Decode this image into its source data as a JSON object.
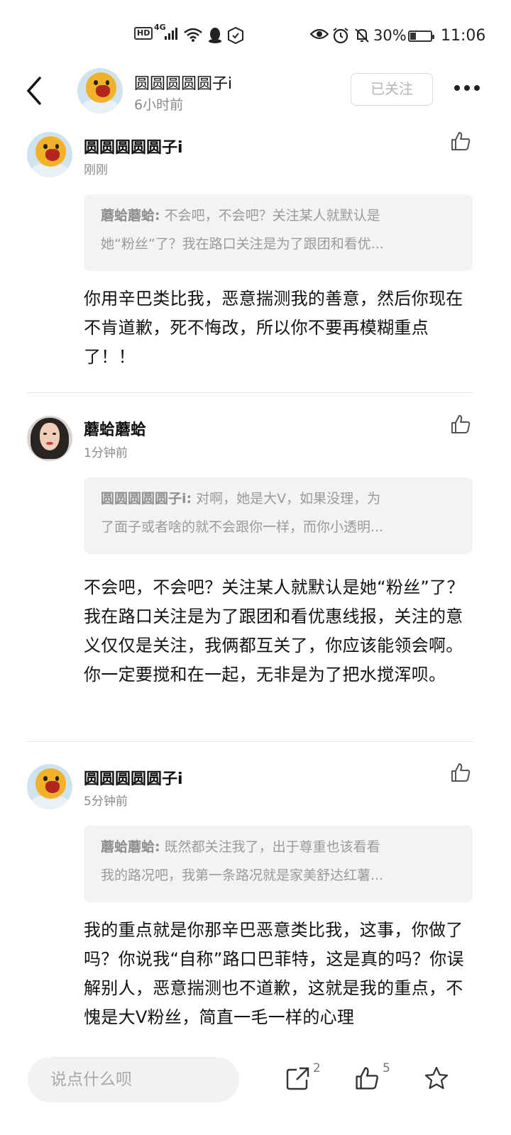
{
  "status_bar": {
    "hd": "HD",
    "network": "4G",
    "battery_pct": "30%",
    "battery_level": 0.3,
    "time": "11:06"
  },
  "header": {
    "author_name": "圆圆圆圆圆子i",
    "post_time": "6小时前",
    "follow_label": "已关注"
  },
  "comments": [
    {
      "author": "圆圆圆圆圆子i",
      "time": "刚刚",
      "quote_author": "蘑蛤蘑蛤:",
      "quote_line1": "不会吧，不会吧？关注某人就默认是",
      "quote_line2": "她“粉丝”了？我在路口关注是为了跟团和看优...",
      "text": "你用辛巴类比我，恶意揣测我的善意，然后你现在不肯道歉，死不悔改，所以你不要再模糊重点了！！"
    },
    {
      "author": "蘑蛤蘑蛤",
      "time": "1分钟前",
      "quote_author": "圆圆圆圆圆子i:",
      "quote_line1": "对啊，她是大V，如果没理，为",
      "quote_line2": "了面子或者啥的就不会跟你一样，而你小透明...",
      "text": "不会吧，不会吧？关注某人就默认是她“粉丝”了？我在路口关注是为了跟团和看优惠线报，关注的意义仅仅是关注，我俩都互关了，你应该能领会啊。你一定要搅和在一起，无非是为了把水搅浑呗。"
    },
    {
      "author": "圆圆圆圆圆子i",
      "time": "5分钟前",
      "quote_author": "蘑蛤蘑蛤:",
      "quote_line1": "既然都关注我了，出于尊重也该看看",
      "quote_line2": "我的路况吧，我第一条路况就是家美舒达红薯...",
      "text": "我的重点就是你那辛巴恶意类比我，这事，你做了吗？你说我“自称”路口巴菲特，这是真的吗？你误解别人，恶意揣测也不道歉，这就是我的重点，不愧是大V粉丝，简直一毛一样的心理"
    }
  ],
  "bottom_bar": {
    "input_placeholder": "说点什么呗",
    "share_count": "2",
    "like_count": "5"
  }
}
